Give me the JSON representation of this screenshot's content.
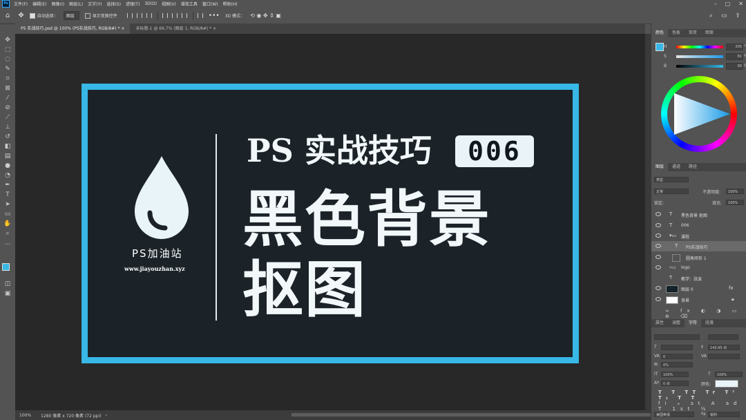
{
  "app": {
    "logo": "Ps"
  },
  "menu": [
    "文件(F)",
    "编辑(E)",
    "图像(I)",
    "图层(L)",
    "文字(Y)",
    "选择(S)",
    "滤镜(T)",
    "3D(D)",
    "视图(V)",
    "增效工具",
    "窗口(W)",
    "帮助(H)"
  ],
  "options": {
    "auto_select_label": "自动选择：",
    "auto_select_value": "图层",
    "show_transform_label": "显示变换控件",
    "mode_label": "3D 模式："
  },
  "tabs": [
    {
      "label": "PS 实战技巧.psd @ 100% (PS实战技巧, RGB/8#) *"
    },
    {
      "label": "未标题-1 @ 66.7% (图层 1, RGB/8#) *"
    }
  ],
  "artwork": {
    "title_line1": "PS 实战技巧",
    "badge": "006",
    "title_line2": "黑色背景",
    "title_line3": "抠图",
    "brand": "PS加油站",
    "url": "www.jiayouzhan.xyz"
  },
  "status": {
    "zoom": "100%",
    "doc_size": "1280 像素 x 720 像素 (72 ppi)"
  },
  "color_panel": {
    "tabs": [
      "颜色",
      "色板",
      "渐变",
      "图案"
    ],
    "h": "205",
    "s": "81",
    "b": "90",
    "fg_color": "#37b8e6"
  },
  "layers_panel": {
    "tabs": [
      "图层",
      "通道",
      "路径"
    ],
    "filter": "类型",
    "blend_mode": "正常",
    "opacity_label": "不透明度:",
    "opacity": "100%",
    "lock_label": "锁定:",
    "fill_label": "填充:",
    "fill": "100%",
    "layers": [
      {
        "type": "T",
        "name": "黑色背景 抠图"
      },
      {
        "type": "T",
        "name": "006"
      },
      {
        "type": "folder",
        "name": "课程"
      },
      {
        "type": "T",
        "name": "PS实战技巧"
      },
      {
        "type": "shape",
        "name": "圆角矩形 1"
      },
      {
        "type": "folder",
        "name": "logo"
      },
      {
        "type": "T",
        "name": "教学：张波"
      },
      {
        "type": "fill",
        "name": "图层 0"
      },
      {
        "type": "fill",
        "name": "背景"
      }
    ]
  },
  "char_panel": {
    "tabs": [
      "属性",
      "调整",
      "字符",
      "段落"
    ],
    "size": "143.95 点",
    "tracking": "0",
    "scale_v": "0%",
    "scale_h_left": "100%",
    "scale_h_right": "100%",
    "baseline": "0 点",
    "color_label": "颜色:",
    "language": "美国英语",
    "aa": "锐利"
  }
}
